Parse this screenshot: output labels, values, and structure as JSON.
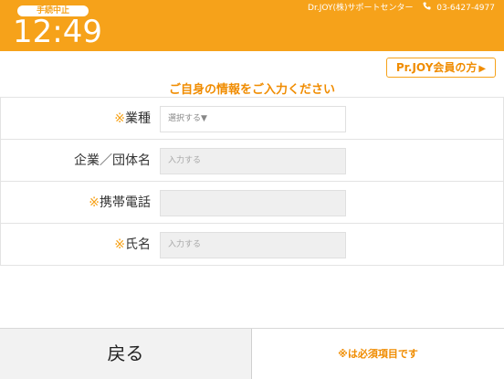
{
  "header": {
    "status": "手続中止",
    "clock": "12:49",
    "support_name": "Dr.JOY(株)サポートセンター",
    "support_phone": "03-6427-4977",
    "accent_color": "#f6a21a"
  },
  "pr_button": {
    "label": "Pr.JOY会員の方",
    "arrow": "▶"
  },
  "instruction": "ご自身の情報をご入力ください",
  "form": {
    "rows": [
      {
        "required_mark": "※",
        "label": "業種",
        "value": "選択する▼"
      },
      {
        "required_mark": "",
        "label": "企業／団体名",
        "placeholder": "入力する"
      },
      {
        "required_mark": "※",
        "label": "携帯電話",
        "placeholder": ""
      },
      {
        "required_mark": "※",
        "label": "氏名",
        "placeholder": "入力する"
      }
    ]
  },
  "footer": {
    "back_label": "戻る",
    "required_note": "※は必須項目です"
  }
}
